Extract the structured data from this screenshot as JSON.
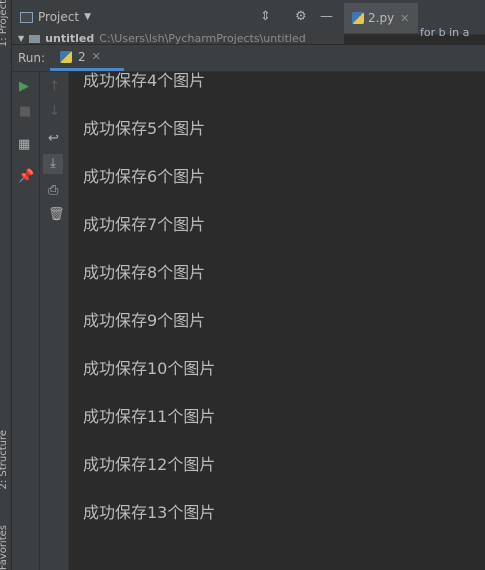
{
  "side_labels": {
    "project": "1: Project",
    "structure": "2: Structure",
    "favorites": "Favorites"
  },
  "toolbar": {
    "project_label": "Project",
    "file_tab": "2.py",
    "right_code": "for b in a"
  },
  "project_tree": {
    "name": "untitled",
    "path": "C:\\Users\\lsh\\PycharmProjects\\untitled"
  },
  "run": {
    "label": "Run:",
    "tab": "2"
  },
  "console_lines": [
    "成功保存4个图片",
    "成功保存5个图片",
    "成功保存6个图片",
    "成功保存7个图片",
    "成功保存8个图片",
    "成功保存9个图片",
    "成功保存10个图片",
    "成功保存11个图片",
    "成功保存12个图片",
    "成功保存13个图片"
  ],
  "icons": {
    "run": "play-icon",
    "stop": "stop-icon",
    "layout": "layout-icon",
    "pin": "pin-icon",
    "up": "arrow-up-icon",
    "down": "arrow-down-icon",
    "wrap": "soft-wrap-icon",
    "scroll": "scroll-to-end-icon",
    "print": "print-icon",
    "trash": "trash-icon"
  },
  "colors": {
    "run_green": "#499c54",
    "accent_blue": "#4a88c7"
  }
}
